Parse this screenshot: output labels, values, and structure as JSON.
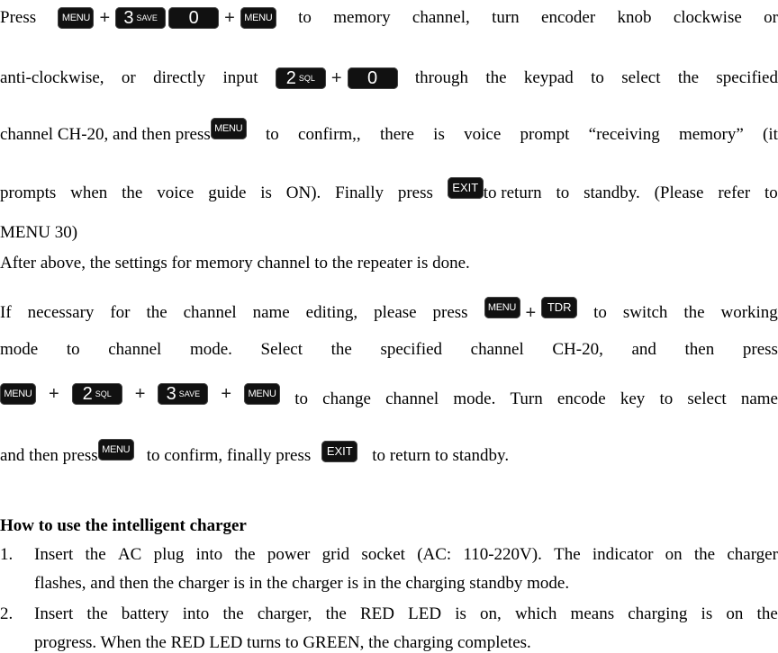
{
  "paragraph1": {
    "line1": {
      "start": "Press",
      "keys_a": [
        "MENU",
        "3|SAVE",
        "0",
        "MENU"
      ],
      "words": [
        "to",
        "memory",
        "channel,",
        "turn",
        "encoder",
        "knob",
        "clockwise",
        "or"
      ]
    },
    "line2": {
      "words_before": [
        "anti-clockwise,",
        "or",
        "directly",
        "input"
      ],
      "keys": [
        "2|SQL",
        "0"
      ],
      "words_after": [
        "through",
        "the",
        "keypad",
        "to",
        "select",
        "the",
        "specified"
      ]
    },
    "line3": {
      "before": "channel CH-20, and then press",
      "key": "MENU",
      "after_words": [
        "to",
        "confirm,,",
        "there",
        "is",
        "voice",
        "prompt",
        "“receiving",
        "memory”",
        "(it"
      ]
    },
    "line4": {
      "before_words": [
        "prompts",
        "when",
        "the",
        "voice",
        "guide",
        "is",
        "ON).",
        "Finally",
        "press"
      ],
      "key": "EXIT",
      "after_words": [
        "to return",
        "to",
        "standby.",
        "(Please",
        "refer",
        "to"
      ]
    },
    "line5": "MENU 30)",
    "line6": "After above, the settings for memory channel to the repeater is done."
  },
  "paragraph2": {
    "line1": {
      "before_words": [
        "If",
        "necessary",
        "for",
        "the",
        "channel",
        "name",
        "editing,",
        "please",
        "press"
      ],
      "keys": [
        "MENU",
        "TDR"
      ],
      "after_words": [
        "to",
        "switch",
        "the",
        "working"
      ]
    },
    "line2": {
      "words": [
        "mode",
        "to",
        "channel",
        "mode.",
        "Select",
        "the",
        "specified",
        "channel",
        "CH-20,",
        "and",
        "then",
        "press"
      ]
    },
    "line3": {
      "keys": [
        "MENU",
        "2|SQL",
        "3|SAVE",
        "MENU"
      ],
      "after_words": [
        "to",
        "change",
        "channel",
        "mode.",
        "Turn",
        "encode",
        "key",
        "to",
        "select",
        "name"
      ]
    },
    "line4": {
      "before": "and then press",
      "key1": "MENU",
      "middle": "to confirm, finally press",
      "key2": "EXIT",
      "after": "to return to standby."
    }
  },
  "charger_section": {
    "heading": "How to use the intelligent charger",
    "items": [
      {
        "number": "1.",
        "line1_words": [
          "Insert",
          "the",
          "AC",
          "plug",
          "into",
          "the",
          "power",
          "grid",
          "socket",
          "(AC:",
          "110-220V).",
          "The",
          "indicator",
          "on",
          "the",
          "charger"
        ],
        "line2": "flashes, and then the charger is in the charger is in the charging standby mode."
      },
      {
        "number": "2.",
        "line1_words": [
          "Insert",
          "the",
          "battery",
          "into",
          "the",
          "charger,",
          "the",
          "RED",
          "LED",
          "is",
          "on,",
          "which",
          "means",
          "charging",
          "is",
          "on",
          "the"
        ],
        "line2": "progress. When the RED LED turns to GREEN, the charging completes."
      }
    ]
  },
  "key_icons": {
    "menu": "MENU",
    "exit": "EXIT",
    "tdr": "TDR",
    "save_big": "3",
    "save_small": "SAVE",
    "sql_big": "2",
    "sql_small": "SQL",
    "zero": "0",
    "plus": "+"
  }
}
